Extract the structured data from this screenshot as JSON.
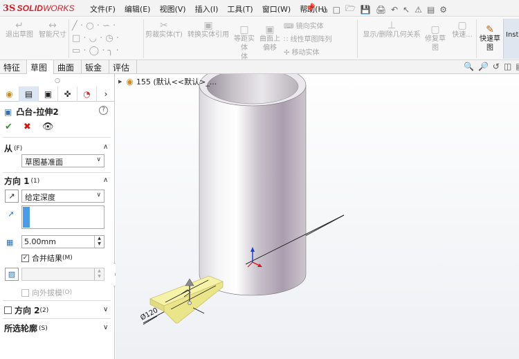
{
  "app": {
    "logo_ds": "3S",
    "logo_solid": "SOLID",
    "logo_works": "WORKS"
  },
  "menu": [
    "文件(F)",
    "编辑(E)",
    "视图(V)",
    "插入(I)",
    "工具(T)",
    "窗口(W)",
    "帮助(H)"
  ],
  "commands": {
    "exit_sketch": "退出草图",
    "smart_dim": "智能尺寸",
    "trim": "剪裁实体(T)",
    "convert": "转换实体引用",
    "offset": "等距实体",
    "offset_line2": "体",
    "surface_offset": "曲面上",
    "surface_offset_line2": "偏移",
    "mirror": "镜向实体",
    "linear_pattern": "线性草图阵列",
    "move": "移动实体",
    "display_relations": "显示/删除几何关系",
    "repair": "修复草",
    "repair_line2": "图",
    "quick": "快速...",
    "quick_sketch": "快速草",
    "quick_sketch_line2": "图",
    "insta": "Insta"
  },
  "tabs": [
    "特征",
    "草图",
    "曲面",
    "钣金",
    "评估"
  ],
  "active_tab": "草图",
  "property_manager": {
    "title": "凸台-拉伸2",
    "from_label": "从",
    "from_hotkey": "(F)",
    "from_value": "草图基准面",
    "direction1_label": "方向 1",
    "direction1_hotkey": "(1)",
    "end_condition": "给定深度",
    "depth": "5.00mm",
    "merge_label": "合并结果",
    "merge_hotkey": "(M)",
    "merge_checked": true,
    "draft_label": "向外拔模",
    "draft_hotkey": "(O)",
    "direction2_label": "方向 2",
    "direction2_hotkey": "(2)",
    "contours_label": "所选轮廓",
    "contours_hotkey": "(S)"
  },
  "tree": {
    "text": "155 (默认<<默认>_..."
  },
  "dimension": {
    "text": "Ø120"
  },
  "colors": {
    "brand": "#d0202a",
    "accent": "#2e6fb5",
    "sketch_fill": "#f3f0a0",
    "cylinder": "#b0a8b4"
  }
}
